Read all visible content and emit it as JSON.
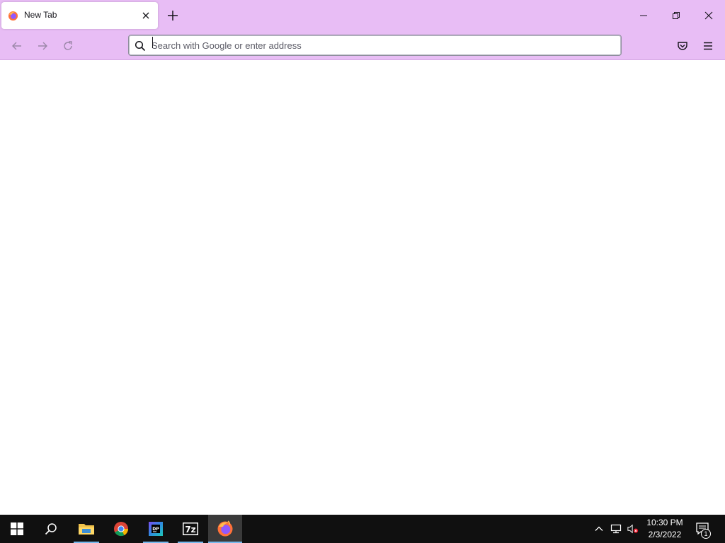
{
  "browser": {
    "tab": {
      "title": "New Tab"
    },
    "urlbar": {
      "placeholder": "Search with Google or enter address",
      "value": ""
    },
    "accent_color": "#e8bdf5"
  },
  "icons": {
    "tab_favicon": "firefox-icon",
    "tab_close": "close-icon",
    "new_tab": "plus-icon",
    "back": "arrow-left-icon",
    "forward": "arrow-right-icon",
    "reload": "reload-icon",
    "search": "search-icon",
    "pocket": "pocket-icon",
    "menu": "hamburger-menu-icon",
    "minimize": "minimize-icon",
    "maximize": "restore-icon",
    "close_window": "close-icon"
  },
  "taskbar": {
    "apps": [
      "start",
      "search",
      "file-explorer",
      "chrome",
      "datapad",
      "7-zip",
      "firefox"
    ],
    "seven_zip_label": "7z",
    "datapad_label": "DP",
    "clock": {
      "time": "10:30 PM",
      "date": "2/3/2022"
    },
    "notification_count": "1"
  }
}
